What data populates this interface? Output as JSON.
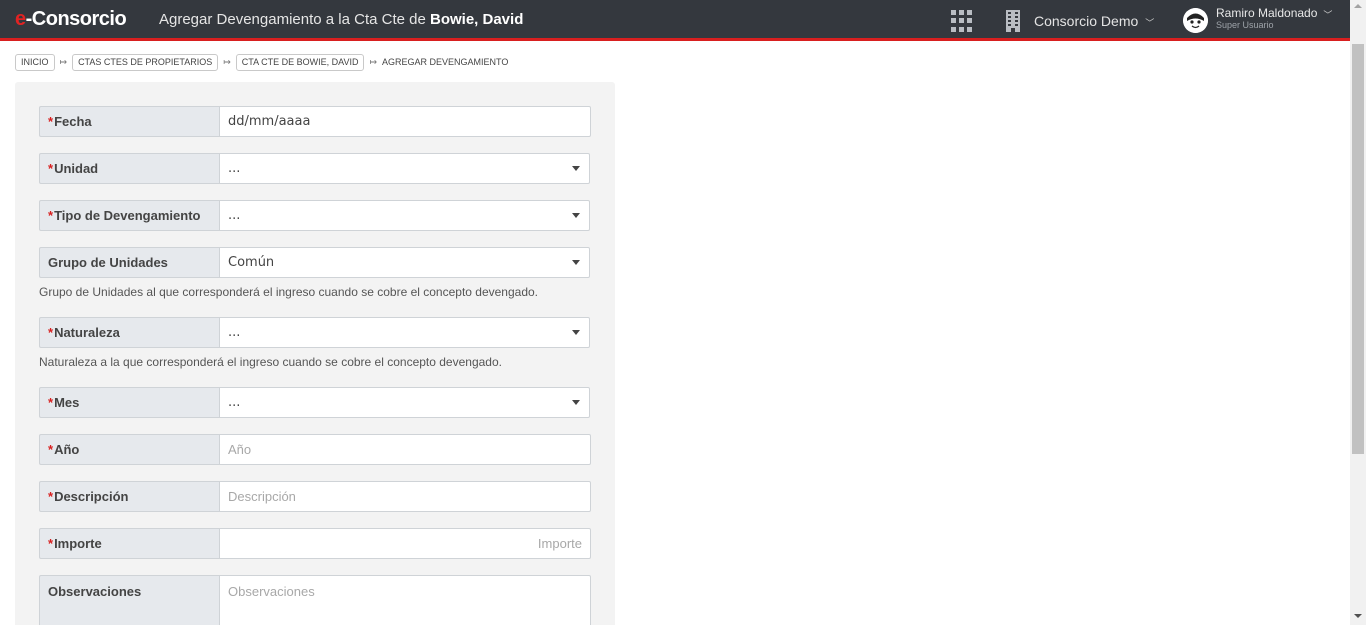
{
  "header": {
    "logo_e": "e",
    "logo_rest": "-Consorcio",
    "title_prefix": "Agregar Devengamiento a la Cta Cte de",
    "title_name": "Bowie, David",
    "consorcio_label": "Consorcio Demo",
    "user_name": "Ramiro Maldonado",
    "user_role": "Super Usuario"
  },
  "breadcrumb": {
    "items": [
      "INICIO",
      "CTAS CTES DE PROPIETARIOS",
      "CTA CTE DE BOWIE, DAVID"
    ],
    "current": "AGREGAR DEVENGAMIENTO",
    "separator": "↦"
  },
  "form": {
    "required_mark": "*",
    "fecha": {
      "label": "Fecha",
      "value": "dd/mm/aaaa"
    },
    "unidad": {
      "label": "Unidad",
      "value": "..."
    },
    "tipo": {
      "label": "Tipo de Devengamiento",
      "value": "..."
    },
    "grupo": {
      "label": "Grupo de Unidades",
      "value": "Común",
      "help": "Grupo de Unidades al que corresponderá el ingreso cuando se cobre el concepto devengado."
    },
    "naturaleza": {
      "label": "Naturaleza",
      "value": "...",
      "help": "Naturaleza a la que corresponderá el ingreso cuando se cobre el concepto devengado."
    },
    "mes": {
      "label": "Mes",
      "value": "..."
    },
    "anio": {
      "label": "Año",
      "placeholder": "Año"
    },
    "descripcion": {
      "label": "Descripción",
      "placeholder": "Descripción"
    },
    "importe": {
      "label": "Importe",
      "placeholder": "Importe"
    },
    "observaciones": {
      "label": "Observaciones",
      "placeholder": "Observaciones"
    }
  },
  "colors": {
    "topbar": "#34383e",
    "accent_red": "#d81f1f",
    "panel": "#f3f3f3",
    "label_bg": "#e6e9ed"
  }
}
